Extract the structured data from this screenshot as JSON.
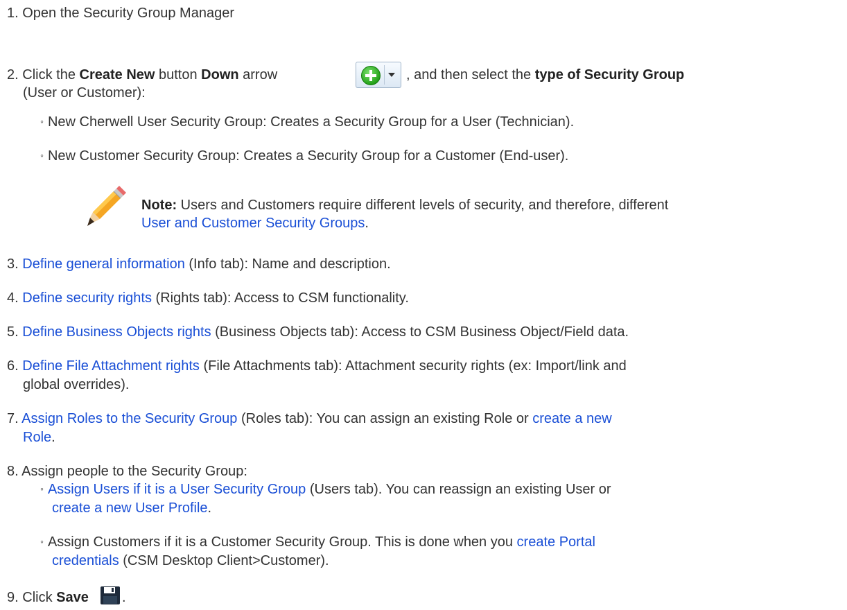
{
  "steps": [
    {
      "num": "1.",
      "text": "Open the Security Group Manager"
    },
    {
      "num": "2.",
      "pre": "Click the ",
      "bold1": "Create New",
      "mid1": " button ",
      "bold2": "Down",
      "mid2": " arrow",
      "post": ", and then select the ",
      "bold3": "type of Security Group",
      "line2": "(User or Customer):",
      "bullets": [
        "New Cherwell User Security Group: Creates a Security Group for a User (Technician).",
        "New Customer Security Group: Creates a Security Group for a Customer (End-user)."
      ],
      "note": {
        "label": "Note:",
        "text": " Users and Customers require different levels of security, and therefore, different",
        "link": "User and Customer Security Groups",
        "end": "."
      }
    },
    {
      "num": "3.",
      "link": "Define general information",
      "text": " (Info tab): Name and description."
    },
    {
      "num": "4.",
      "link": "Define security rights",
      "text": " (Rights tab): Access to CSM functionality."
    },
    {
      "num": "5.",
      "link": "Define Business Objects rights",
      "text": " (Business Objects tab): Access to CSM Business Object/Field data."
    },
    {
      "num": "6.",
      "link": "Define File Attachment rights",
      "text": " (File Attachments tab): Attachment security rights (ex: Import/link and",
      "line2": "global overrides)."
    },
    {
      "num": "7.",
      "link": "Assign Roles to the Security Group",
      "text": " (Roles tab): You can assign an existing Role or ",
      "link2": "create a new",
      "line2_link": "Role",
      "line2_end": "."
    },
    {
      "num": "8.",
      "text": "Assign people to the Security Group:",
      "bullets": [
        {
          "link": "Assign Users if it is a User Security Group",
          "text": " (Users tab). You can reassign an existing User or",
          "line2_link": "create a new User Profile",
          "line2_end": "."
        },
        {
          "text": "Assign Customers if it is a Customer Security Group. This is done when you ",
          "link": "create Portal",
          "line2_link": "credentials",
          "line2_end": " (CSM Desktop Client>Customer)."
        }
      ]
    },
    {
      "num": "9.",
      "pre": "Click ",
      "bold": "Save",
      "end": "."
    }
  ],
  "bullet_glyph": "◦",
  "colors": {
    "link": "#1a4fd6",
    "text": "#333333"
  },
  "icons": {
    "create": "create-new-plus-icon",
    "note": "pencil-icon",
    "save": "floppy-disk-save-icon"
  }
}
